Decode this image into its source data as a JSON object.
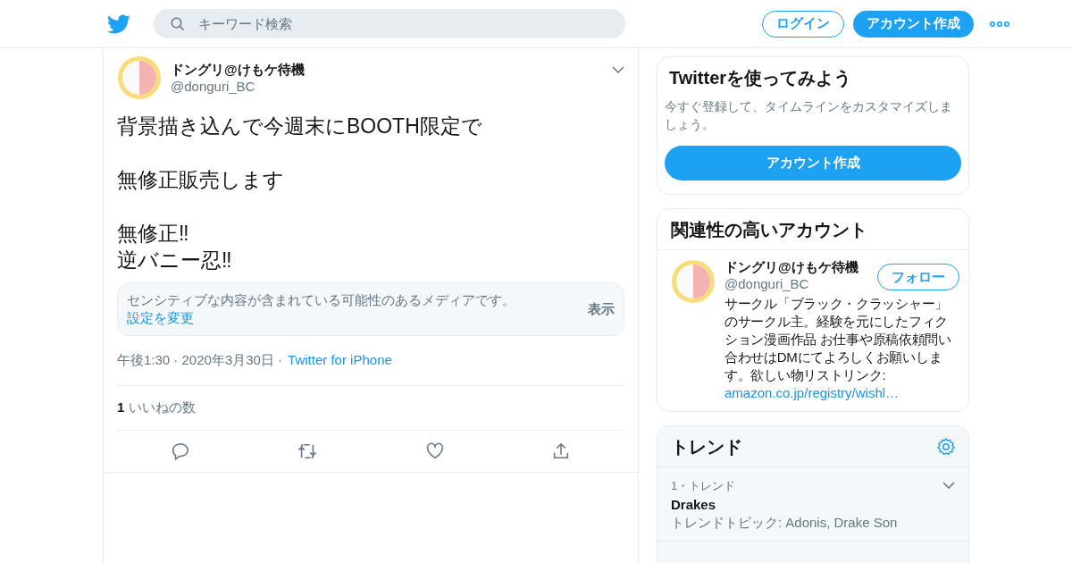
{
  "header": {
    "search_placeholder": "キーワード検索",
    "login": "ログイン",
    "signup": "アカウント作成"
  },
  "tweet": {
    "name": "ドングリ@けもケ待機",
    "handle": "@donguri_BC",
    "paragraphs": [
      "背景描き込んで今週末にBOOTH限定で",
      "無修正販売します",
      "無修正‼\n逆バニー忍‼"
    ],
    "notice": {
      "text": "センシティブな内容が含まれている可能性のあるメディアです。",
      "link": "設定を変更",
      "button": "表示"
    },
    "meta": "午後1:30 · 2020年3月30日 ·",
    "source": "Twitter for iPhone",
    "likes": "**1** いいねの数"
  },
  "signup_card": {
    "title": "Twitterを使ってみよう",
    "text": "今すぐ登録して、タイムラインをカスタマイズしましょう。",
    "button": "アカウント作成"
  },
  "related": {
    "title": "関連性の高いアカウント",
    "accounts": [
      {
        "name": "ドングリ@けもケ待機",
        "handle": "@donguri_BC",
        "follow": "フォロー",
        "bio": "サークル「ブラック・クラッシャー」のサークル主。経験を元にしたフィクション漫画作品 お仕事や原稿依頼問い合わせはDMにてよろしくお願いします。欲しい物リストリンク:",
        "link": "amazon.co.jp/registry/wishl…"
      }
    ]
  },
  "trends": {
    "title": "トレンド",
    "items": [
      {
        "rank": "1・トレンド",
        "name": "Drakes",
        "topic": "トレンドトピック: Adonis, Drake Son"
      }
    ]
  }
}
